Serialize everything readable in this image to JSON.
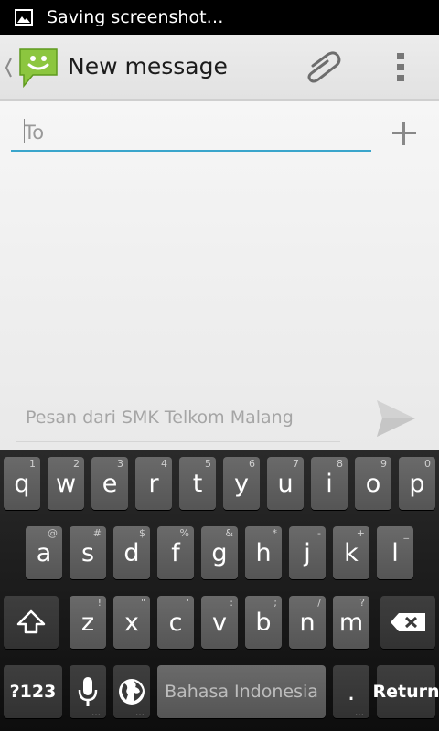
{
  "status_bar": {
    "notification_icon": "image-icon",
    "text": "Saving screenshot…"
  },
  "action_bar": {
    "title": "New message",
    "icons": [
      "up-caret-icon",
      "messaging-app-icon",
      "paperclip-icon",
      "overflow-menu-icon"
    ]
  },
  "recipient": {
    "placeholder": "To",
    "add_icon": "plus-icon"
  },
  "compose": {
    "placeholder": "Pesan dari SMK Telkom Malang",
    "send_icon": "send-icon"
  },
  "keyboard": {
    "row1": [
      {
        "label": "q",
        "hint": "1"
      },
      {
        "label": "w",
        "hint": "2"
      },
      {
        "label": "e",
        "hint": "3"
      },
      {
        "label": "r",
        "hint": "4"
      },
      {
        "label": "t",
        "hint": "5"
      },
      {
        "label": "y",
        "hint": "6"
      },
      {
        "label": "u",
        "hint": "7"
      },
      {
        "label": "i",
        "hint": "8"
      },
      {
        "label": "o",
        "hint": "9"
      },
      {
        "label": "p",
        "hint": "0"
      }
    ],
    "row2": [
      {
        "label": "a",
        "hint": "@"
      },
      {
        "label": "s",
        "hint": "#"
      },
      {
        "label": "d",
        "hint": "$"
      },
      {
        "label": "f",
        "hint": "%"
      },
      {
        "label": "g",
        "hint": "&"
      },
      {
        "label": "h",
        "hint": "*"
      },
      {
        "label": "j",
        "hint": "-"
      },
      {
        "label": "k",
        "hint": "+"
      },
      {
        "label": "l",
        "hint": "_"
      }
    ],
    "row3": [
      {
        "label": "z",
        "hint": "!"
      },
      {
        "label": "x",
        "hint": "\""
      },
      {
        "label": "c",
        "hint": "'"
      },
      {
        "label": "v",
        "hint": ":"
      },
      {
        "label": "b",
        "hint": ";"
      },
      {
        "label": "n",
        "hint": "/"
      },
      {
        "label": "m",
        "hint": "?"
      }
    ],
    "symbols_label": "?123",
    "space_label": "Bahasa Indonesia",
    "period_label": ".",
    "return_label": "Return",
    "more_dots": "…",
    "icons": [
      "shift-icon",
      "backspace-icon",
      "microphone-icon",
      "globe-icon"
    ]
  }
}
